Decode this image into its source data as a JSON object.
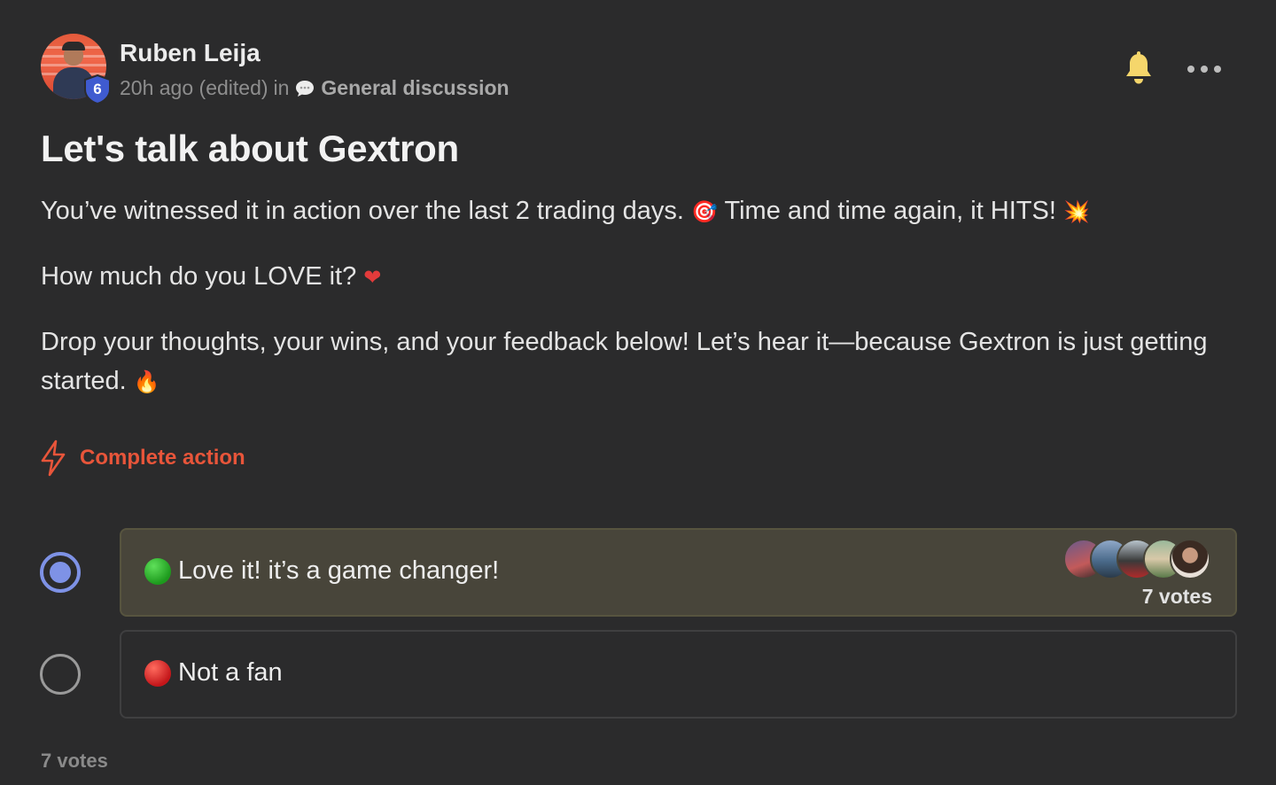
{
  "post": {
    "author": "Ruben Leija",
    "level_badge": "6",
    "time": "20h ago (edited)",
    "in_label": "in",
    "channel": "General discussion",
    "title": "Let's talk about Gextron",
    "paragraph1_text": "You’ve witnessed it in action over the last 2 trading days.",
    "paragraph1_emoji1": "🎯",
    "paragraph1_text2": "Time and time again, it HITS!",
    "paragraph1_emoji2": "💥",
    "paragraph2_text": "How much do you LOVE it?",
    "paragraph2_emoji": "❤",
    "paragraph3_text": "Drop your thoughts, your wins, and your feedback below! Let’s hear it—because Gextron is just getting started.",
    "paragraph3_emoji": "🔥",
    "action_label": "Complete action"
  },
  "poll": {
    "options": [
      {
        "label": "Love it! it’s a game changer!",
        "votes_label": "7 votes",
        "selected": true,
        "icon": "green-circle-icon"
      },
      {
        "label": "Not a fan",
        "votes_label": "",
        "selected": false,
        "icon": "red-circle-icon"
      }
    ],
    "total_votes_label": "7 votes"
  },
  "colors": {
    "background": "#2b2b2c",
    "accent": "#e8553a",
    "bell": "#f5d66b",
    "radio_selected": "#7e92e6",
    "voted_option_bg": "#48453a",
    "badge": "#3f5bd0"
  }
}
